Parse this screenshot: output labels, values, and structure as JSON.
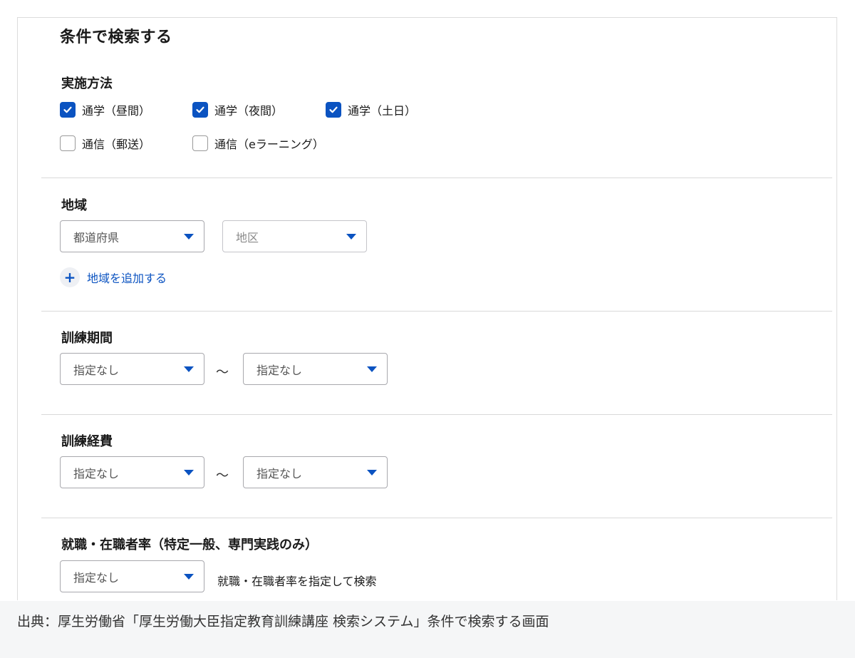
{
  "title": "条件で検索する",
  "method": {
    "label": "実施方法",
    "options": [
      {
        "label": "通学（昼間）",
        "checked": true
      },
      {
        "label": "通学（夜間）",
        "checked": true
      },
      {
        "label": "通学（土日）",
        "checked": true
      },
      {
        "label": "通信（郵送）",
        "checked": false
      },
      {
        "label": "通信（eラーニング）",
        "checked": false
      }
    ]
  },
  "region": {
    "label": "地域",
    "prefecture_placeholder": "都道府県",
    "district_placeholder": "地区",
    "add_label": "地域を追加する"
  },
  "period": {
    "label": "訓練期間",
    "from": "指定なし",
    "tilde": "～",
    "to": "指定なし"
  },
  "cost": {
    "label": "訓練経費",
    "from": "指定なし",
    "tilde": "～",
    "to": "指定なし"
  },
  "employment": {
    "label": "就職・在職者率（特定一般、専門実践のみ）",
    "value": "指定なし",
    "note": "就職・在職者率を指定して検索"
  },
  "caption": "出典：厚生労働省「厚生労働大臣指定教育訓練講座 検索システム」条件で検索する画面",
  "colors": {
    "accent": "#0b53c1",
    "divider": "#d9d9d9",
    "caption_bg": "#f5f6f7"
  }
}
